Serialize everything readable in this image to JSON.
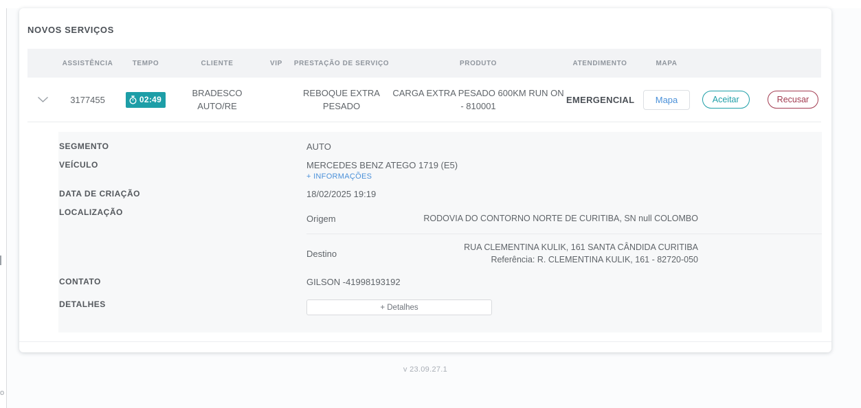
{
  "page": {
    "title": "NOVOS SERVIÇOS",
    "version": "v 23.09.27.1"
  },
  "colors": {
    "accent_teal": "#1d9ea7",
    "link_blue": "#4a90d9",
    "danger_red": "#a23b50",
    "header_band_bg": "#f2f3f5",
    "detail_panel_bg": "#f7f8f9"
  },
  "table": {
    "headers": {
      "assistencia": "ASSISTÊNCIA",
      "tempo": "TEMPO",
      "cliente": "CLIENTE",
      "vip": "VIP",
      "prestacao": "PRESTAÇÃO DE SERVIÇO",
      "produto": "PRODUTO",
      "atendimento": "ATENDIMENTO",
      "mapa": "MAPA"
    },
    "row": {
      "assistencia": "3177455",
      "tempo": "02:49",
      "cliente": "BRADESCO AUTO/RE",
      "vip": "",
      "prestacao": "REBOQUE EXTRA PESADO",
      "produto": "CARGA EXTRA PESADO 600KM RUN ON - 810001",
      "atendimento": "EMERGENCIAL",
      "mapa_button": "Mapa",
      "accept_button": "Aceitar",
      "refuse_button": "Recusar"
    }
  },
  "details": {
    "segmento_label": "SEGMENTO",
    "segmento_value": "AUTO",
    "veiculo_label": "VEÍCULO",
    "veiculo_value": "MERCEDES BENZ ATEGO 1719 (E5)",
    "veiculo_link": "+ INFORMAÇÕES",
    "data_criacao_label": "DATA DE CRIAÇÃO",
    "data_criacao_value": "18/02/2025 19:19",
    "localizacao_label": "LOCALIZAÇÃO",
    "origem_label": "Origem",
    "origem_value": "RODOVIA DO CONTORNO NORTE DE CURITIBA, SN null COLOMBO",
    "destino_label": "Destino",
    "destino_line1": "RUA CLEMENTINA KULIK, 161 SANTA CÂNDIDA CURITIBA",
    "destino_line2": "Referência: R. CLEMENTINA KULIK, 161 - 82720-050",
    "contato_label": "CONTATO",
    "contato_value": "GILSON -41998193192",
    "detalhes_label": "DETALHES",
    "detalhes_button": "+ Detalhes"
  }
}
